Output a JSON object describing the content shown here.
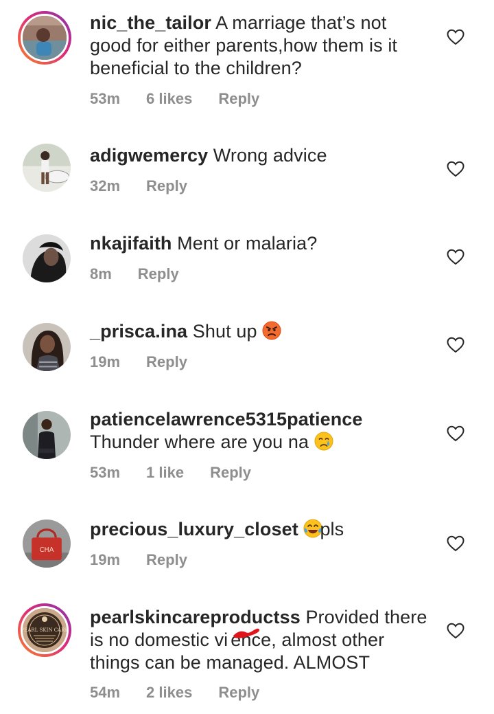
{
  "comments": [
    {
      "username": "nic_the_tailor",
      "text": "A marriage that’s not good for either parents,how them is it beneficial to the children?",
      "time": "53m",
      "likes": "6 likes",
      "reply": "Reply"
    },
    {
      "username": "adigwemercy",
      "text": "Wrong advice",
      "time": "32m",
      "reply": "Reply"
    },
    {
      "username": "nkajifaith",
      "text": "Ment or malaria?",
      "time": "8m",
      "reply": "Reply"
    },
    {
      "username": "_prisca.ina",
      "text": "Shut up",
      "emoji": "pouting-face-emoji",
      "time": "19m",
      "reply": "Reply"
    },
    {
      "username": "patiencelawrence5315patience",
      "text": "Thunder where are you na",
      "emoji": "crying-face-emoji",
      "time": "53m",
      "likes": "1 like",
      "reply": "Reply"
    },
    {
      "username": "precious_luxury_closet",
      "emoji": "tears-of-joy-emoji",
      "text": "pls",
      "time": "19m",
      "reply": "Reply"
    },
    {
      "username": "pearlskincareproductss",
      "text_line1": "Provided there",
      "text_line2a": "is no domestic vi",
      "text_line2b": "ence, almost other",
      "text_line3": "things can be managed. ALMOST",
      "time": "54m",
      "likes": "2 likes",
      "reply": "Reply"
    }
  ],
  "avatar_logo_text": "PEARL SKIN CARE",
  "avatar_bag_text": "CHA"
}
